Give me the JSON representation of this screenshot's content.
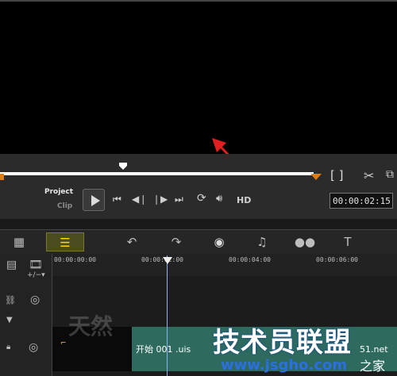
{
  "player": {
    "mode_project": "Project",
    "mode_clip": "Clip",
    "hd_label": "HD",
    "timecode": "00:00:02:15",
    "markers": "[ ]"
  },
  "toolbar": {
    "items": [
      "storyboard-view",
      "timeline-view",
      "undo",
      "redo",
      "record-capture",
      "sound-mixer",
      "auto-music",
      "title"
    ]
  },
  "timeline": {
    "ruler": [
      "00:00:00:00",
      "00:00:02:00",
      "00:00:04:00",
      "00:00:06:00"
    ],
    "clip_label": "开始 001 .uis"
  },
  "watermark": {
    "text": "技术员联盟",
    "url": "www.jsgho.com",
    "home": "之家",
    "partial": "51.net",
    "faded": "天然"
  },
  "colors": {
    "scrub_accent": "#e07b10",
    "clip_fill": "#2e6b5e",
    "playhead": "#8fb0ff",
    "annotation_arrow": "#e02020"
  }
}
